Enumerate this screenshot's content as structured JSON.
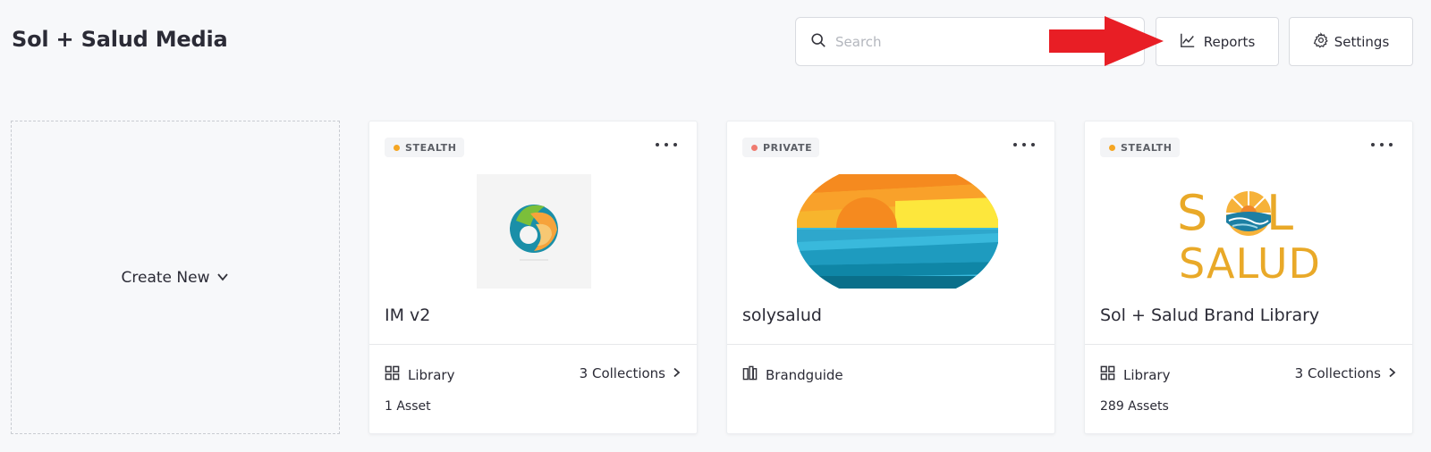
{
  "header": {
    "title": "Sol + Salud Media",
    "search_placeholder": "Search",
    "reports_label": "Reports",
    "settings_label": "Settings"
  },
  "create_new": {
    "label": "Create New"
  },
  "colors": {
    "stealth_dot": "#f5a623",
    "private_dot": "#ef7b6f",
    "arrow": "#e81e25",
    "brand_gold": "#e9a928"
  },
  "cards": [
    {
      "badge": "STEALTH",
      "title": "IM v2",
      "type_label": "Library",
      "type_icon": "grid-icon",
      "collections_label": "3 Collections",
      "assets_label": "1 Asset"
    },
    {
      "badge": "PRIVATE",
      "title": "solysalud",
      "type_label": "Brandguide",
      "type_icon": "brandguide-icon"
    },
    {
      "badge": "STEALTH",
      "title": "Sol + Salud Brand Library",
      "type_label": "Library",
      "type_icon": "grid-icon",
      "collections_label": "3 Collections",
      "assets_label": "289 Assets",
      "logo_text_line1": "S L",
      "logo_text_line2": "SALUD"
    }
  ]
}
